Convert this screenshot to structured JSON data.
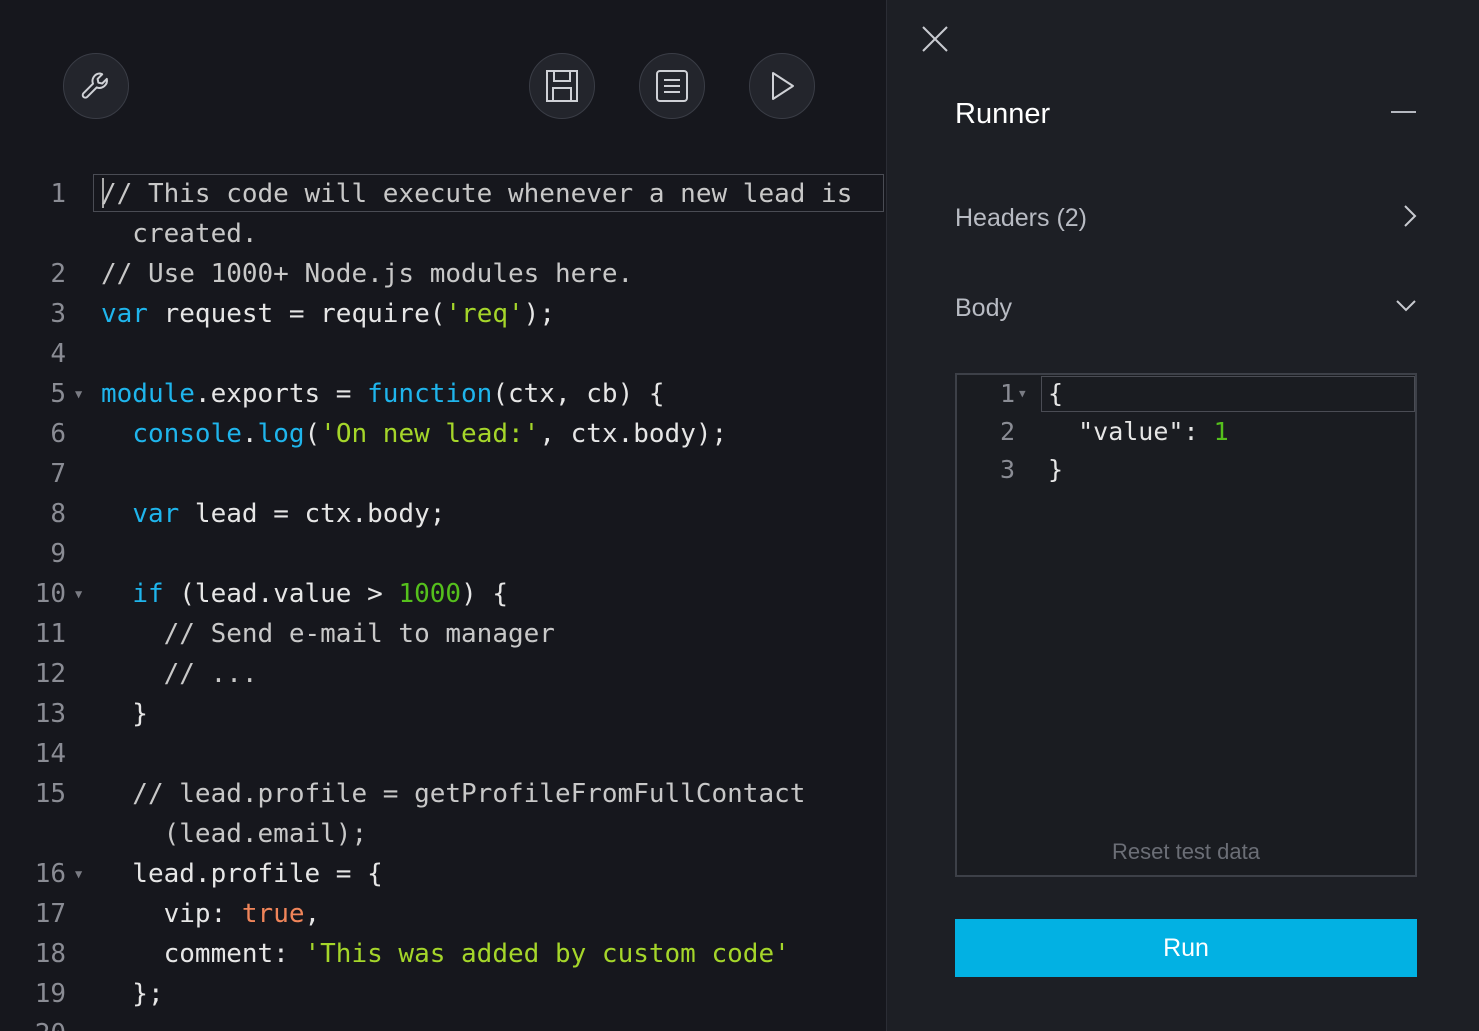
{
  "toolbar": {
    "settings_icon": "wrench-icon",
    "save_icon": "save-icon",
    "logs_icon": "logs-icon",
    "run_icon": "play-icon"
  },
  "editor": {
    "lines": [
      {
        "num": "1",
        "fold": false,
        "segments": [
          {
            "t": "// This code will execute whenever a new lead is",
            "c": "com"
          }
        ]
      },
      {
        "num": "",
        "fold": false,
        "segments": [
          {
            "t": "  created.",
            "c": "com"
          }
        ]
      },
      {
        "num": "2",
        "fold": false,
        "segments": [
          {
            "t": "// Use 1000+ Node.js modules here.",
            "c": "com"
          }
        ]
      },
      {
        "num": "3",
        "fold": false,
        "segments": [
          {
            "t": "var",
            "c": "kw"
          },
          {
            "t": " request = require(",
            "c": ""
          },
          {
            "t": "'req'",
            "c": "str"
          },
          {
            "t": ");",
            "c": ""
          }
        ]
      },
      {
        "num": "4",
        "fold": false,
        "segments": []
      },
      {
        "num": "5",
        "fold": true,
        "segments": [
          {
            "t": "module",
            "c": "kw"
          },
          {
            "t": ".exports = ",
            "c": ""
          },
          {
            "t": "function",
            "c": "kw"
          },
          {
            "t": "(ctx, cb) {",
            "c": ""
          }
        ]
      },
      {
        "num": "6",
        "fold": false,
        "segments": [
          {
            "t": "  ",
            "c": ""
          },
          {
            "t": "console",
            "c": "kw"
          },
          {
            "t": ".",
            "c": ""
          },
          {
            "t": "log",
            "c": "kw"
          },
          {
            "t": "(",
            "c": ""
          },
          {
            "t": "'On new lead:'",
            "c": "str"
          },
          {
            "t": ", ctx.body);",
            "c": ""
          }
        ]
      },
      {
        "num": "7",
        "fold": false,
        "segments": []
      },
      {
        "num": "8",
        "fold": false,
        "segments": [
          {
            "t": "  ",
            "c": ""
          },
          {
            "t": "var",
            "c": "kw"
          },
          {
            "t": " lead = ctx.body;",
            "c": ""
          }
        ]
      },
      {
        "num": "9",
        "fold": false,
        "segments": []
      },
      {
        "num": "10",
        "fold": true,
        "segments": [
          {
            "t": "  ",
            "c": ""
          },
          {
            "t": "if",
            "c": "kw"
          },
          {
            "t": " (lead.value > ",
            "c": ""
          },
          {
            "t": "1000",
            "c": "num"
          },
          {
            "t": ") {",
            "c": ""
          }
        ]
      },
      {
        "num": "11",
        "fold": false,
        "segments": [
          {
            "t": "    // Send e-mail to manager",
            "c": "com"
          }
        ]
      },
      {
        "num": "12",
        "fold": false,
        "segments": [
          {
            "t": "    // ...",
            "c": "com"
          }
        ]
      },
      {
        "num": "13",
        "fold": false,
        "segments": [
          {
            "t": "  }",
            "c": ""
          }
        ]
      },
      {
        "num": "14",
        "fold": false,
        "segments": []
      },
      {
        "num": "15",
        "fold": false,
        "segments": [
          {
            "t": "  // lead.profile = getProfileFromFullContact",
            "c": "com"
          }
        ]
      },
      {
        "num": "",
        "fold": false,
        "segments": [
          {
            "t": "    (lead.email);",
            "c": "com"
          }
        ]
      },
      {
        "num": "16",
        "fold": true,
        "segments": [
          {
            "t": "  lead.profile = {",
            "c": ""
          }
        ]
      },
      {
        "num": "17",
        "fold": false,
        "segments": [
          {
            "t": "    vip: ",
            "c": ""
          },
          {
            "t": "true",
            "c": "bool"
          },
          {
            "t": ",",
            "c": ""
          }
        ]
      },
      {
        "num": "18",
        "fold": false,
        "segments": [
          {
            "t": "    comment: ",
            "c": ""
          },
          {
            "t": "'This was added by custom code'",
            "c": "str"
          }
        ]
      },
      {
        "num": "19",
        "fold": false,
        "segments": [
          {
            "t": "  };",
            "c": ""
          }
        ]
      },
      {
        "num": "20",
        "fold": false,
        "segments": []
      }
    ]
  },
  "runner": {
    "title": "Runner",
    "headers_label": "Headers (2)",
    "body_label": "Body",
    "body_editor": {
      "lines": [
        {
          "num": "1",
          "fold": true,
          "segments": [
            {
              "t": "{",
              "c": ""
            }
          ]
        },
        {
          "num": "2",
          "fold": false,
          "segments": [
            {
              "t": "  \"value\": ",
              "c": ""
            },
            {
              "t": "1",
              "c": "num"
            }
          ]
        },
        {
          "num": "3",
          "fold": false,
          "segments": [
            {
              "t": "}",
              "c": ""
            }
          ]
        }
      ]
    },
    "reset_label": "Reset test data",
    "run_label": "Run"
  },
  "colors": {
    "accent": "#02b1e3",
    "keyword": "#1fb5ec",
    "string": "#a5d62a",
    "number": "#55c01c",
    "boolean": "#f0855a"
  }
}
